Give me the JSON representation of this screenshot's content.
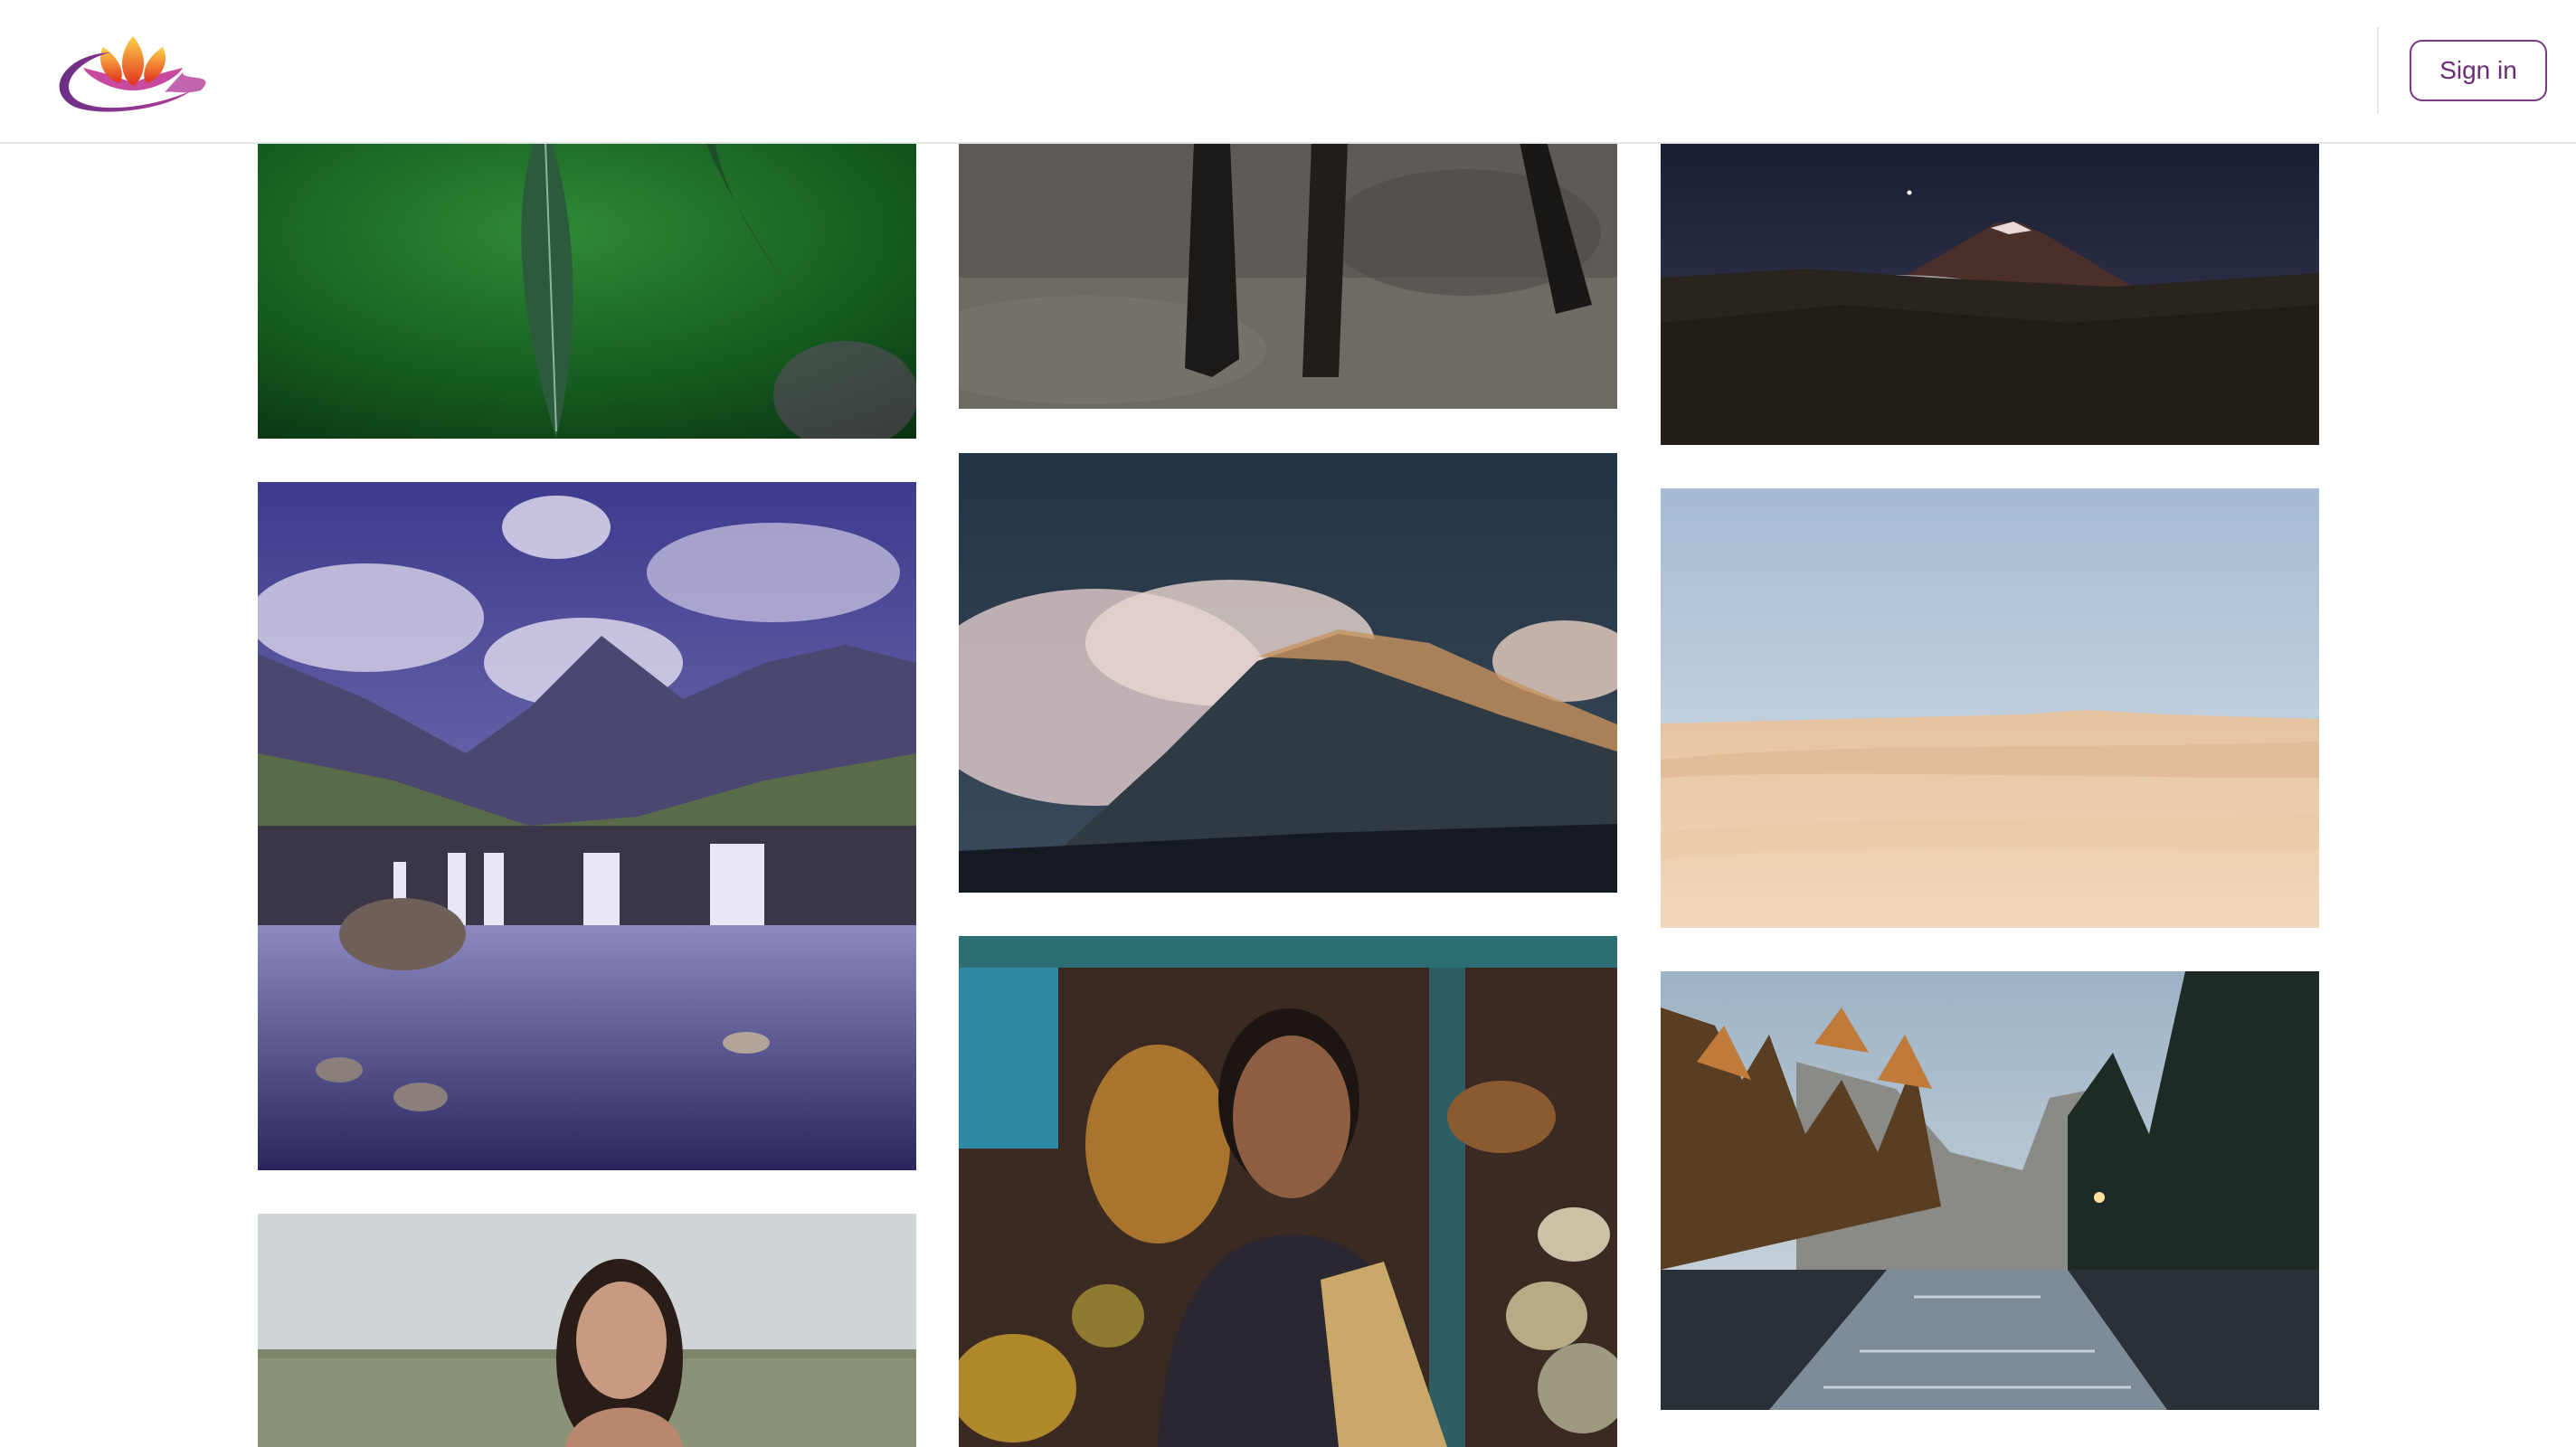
{
  "header": {
    "sign_in_label": "Sign in"
  },
  "icons": {
    "logo": "lotus-logo-icon"
  },
  "colors": {
    "accent": "#7a3a84",
    "header_border": "#e6e6e6"
  },
  "gallery": {
    "columns": 3,
    "photos": [
      {
        "subject": "leaf"
      },
      {
        "subject": "animal-legs"
      },
      {
        "subject": "volcano-night"
      },
      {
        "subject": "waterfall-mountains"
      },
      {
        "subject": "misty-hill-night"
      },
      {
        "subject": "desert-dunes"
      },
      {
        "subject": "woman-meditating"
      },
      {
        "subject": "woman-market"
      },
      {
        "subject": "forest-river-valley"
      }
    ]
  }
}
